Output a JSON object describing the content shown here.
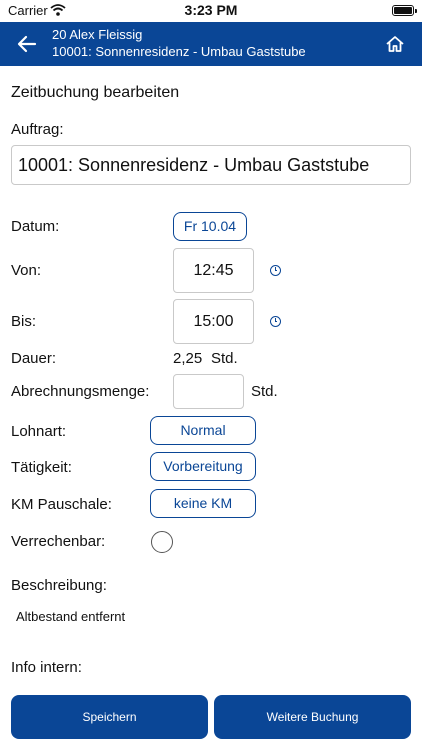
{
  "statusbar": {
    "carrier": "Carrier",
    "time": "3:23 PM"
  },
  "header": {
    "user": "20 Alex Fleissig",
    "order": "10001: Sonnenresidenz - Umbau Gaststube",
    "back_icon": "back-arrow-icon",
    "home_icon": "home-icon"
  },
  "form": {
    "title": "Zeitbuchung bearbeiten",
    "auftrag_label": "Auftrag:",
    "auftrag_value": "10001: Sonnenresidenz - Umbau Gaststube",
    "datum_label": "Datum:",
    "datum_value": "Fr 10.04",
    "von_label": "Von:",
    "von_value": "12:45",
    "bis_label": "Bis:",
    "bis_value": "15:00",
    "dauer_label": "Dauer:",
    "dauer_value": "2,25",
    "dauer_unit": "Std.",
    "menge_label": "Abrechnungsmenge:",
    "menge_value": "",
    "menge_unit": "Std.",
    "lohnart_label": "Lohnart:",
    "lohnart_value": "Normal",
    "taetigkeit_label": "Tätigkeit:",
    "taetigkeit_value": "Vorbereitung",
    "km_label": "KM Pauschale:",
    "km_value": "keine KM",
    "verrechenbar_label": "Verrechenbar:",
    "beschreibung_label": "Beschreibung:",
    "beschreibung_value": "Altbestand entfernt",
    "info_label": "Info intern:"
  },
  "buttons": {
    "save": "Speichern",
    "more": "Weitere Buchung"
  },
  "colors": {
    "primary": "#0a4696",
    "border": "#c9c9c9"
  }
}
